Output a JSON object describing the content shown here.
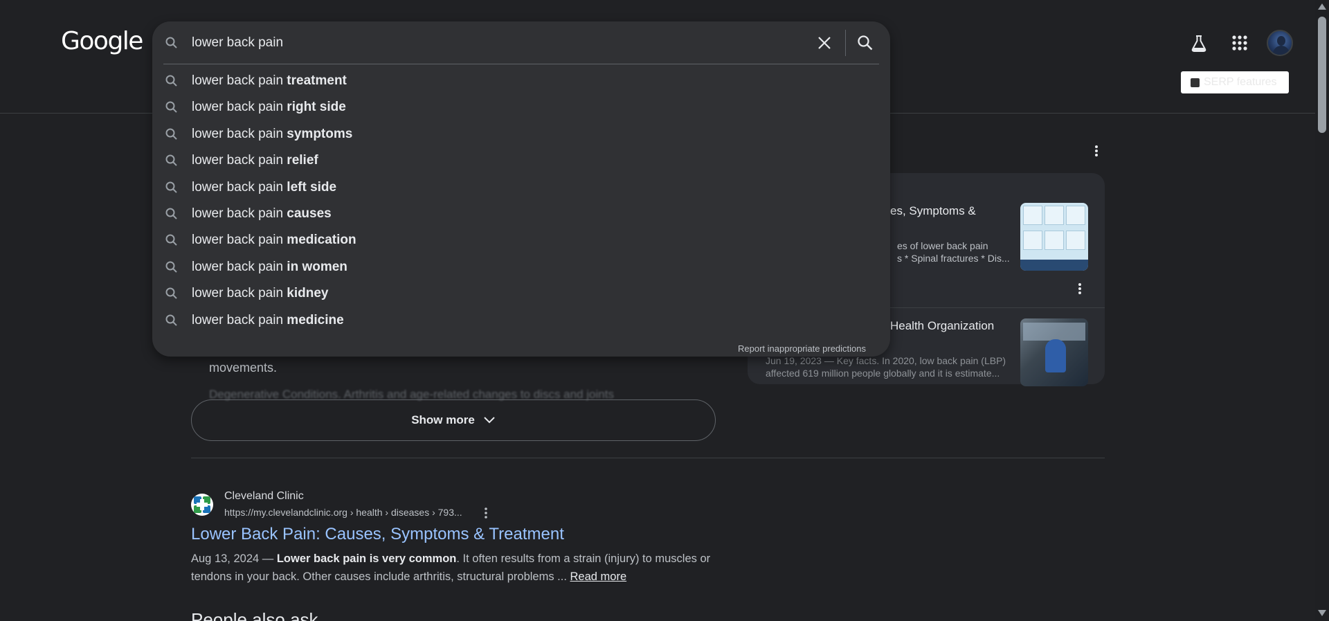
{
  "header": {
    "logo": "Google",
    "serp_features_label": "SERP features",
    "icons": {
      "labs": "flask-icon",
      "apps": "apps-grid-icon",
      "avatar": "account-avatar"
    }
  },
  "search": {
    "query": "lower back pain",
    "suggestions": [
      {
        "prefix": "lower back pain ",
        "completion": "treatment"
      },
      {
        "prefix": "lower back pain ",
        "completion": "right side"
      },
      {
        "prefix": "lower back pain ",
        "completion": "symptoms"
      },
      {
        "prefix": "lower back pain ",
        "completion": "relief"
      },
      {
        "prefix": "lower back pain ",
        "completion": "left side"
      },
      {
        "prefix": "lower back pain ",
        "completion": "causes"
      },
      {
        "prefix": "lower back pain ",
        "completion": "medication"
      },
      {
        "prefix": "lower back pain ",
        "completion": "in women"
      },
      {
        "prefix": "lower back pain ",
        "completion": "kidney"
      },
      {
        "prefix": "lower back pain ",
        "completion": "medicine"
      }
    ],
    "report_label": "Report inappropriate predictions"
  },
  "panel": {
    "item1": {
      "title": "es, Symptoms &",
      "snippet_line1": "es of lower back pain",
      "snippet_line2": "s * Spinal fractures * Dis..."
    },
    "item2": {
      "title": "Health Organization",
      "snippet_line1": "Jun 19, 2023 — Key facts. In 2020, low back pain (LBP)",
      "snippet_line2": "affected 619 million people globally and it is estimate..."
    }
  },
  "main": {
    "partial_text": "movements.",
    "faded_text": "Degenerative Conditions. Arthritis and age-related changes to discs and joints",
    "show_more": "Show more",
    "result": {
      "site_name": "Cleveland Clinic",
      "url": "https://my.clevelandclinic.org › health › diseases › 793...",
      "title": "Lower Back Pain: Causes, Symptoms & Treatment",
      "date": "Aug 13, 2024 — ",
      "bold": "Lower back pain is very common",
      "text1": ". It often results from a strain (injury) to muscles or tendons in your back. Other causes include arthritis, structural problems ... ",
      "read_more": "Read more"
    },
    "people_also_ask": "People also ask"
  },
  "colors": {
    "background": "#202124",
    "dropdown": "#303134",
    "link": "#99c3ff",
    "text": "#e8eaed",
    "muted": "#bdc1c6"
  }
}
